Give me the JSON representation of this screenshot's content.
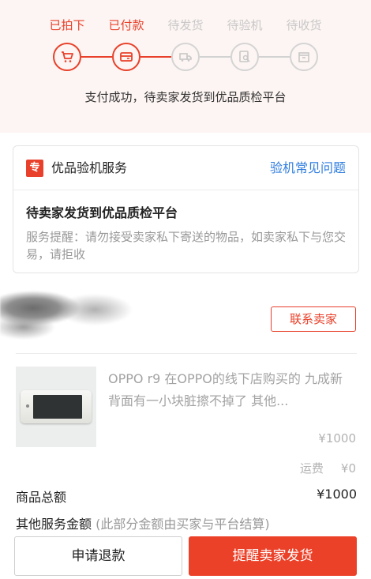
{
  "progress": {
    "steps": [
      {
        "label": "已拍下",
        "state": "active",
        "icon": "cart-icon"
      },
      {
        "label": "已付款",
        "state": "active",
        "icon": "card-icon"
      },
      {
        "label": "待发货",
        "state": "inactive",
        "icon": "truck-icon"
      },
      {
        "label": "待验机",
        "state": "inactive",
        "icon": "inspect-icon"
      },
      {
        "label": "待收货",
        "state": "inactive",
        "icon": "box-icon"
      }
    ],
    "status_text": "支付成功，待卖家发货到优品质检平台"
  },
  "inspection": {
    "badge": "专",
    "title": "优品验机服务",
    "faq_link": "验机常见问题",
    "status": "待卖家发货到优品质检平台",
    "notice": "服务提醒：请勿接受卖家私下寄送的物品，如卖家私下与您交易，请拒收"
  },
  "seller": {
    "contact_label": "联系卖家"
  },
  "product": {
    "title": "OPPO r9 在OPPO的线下店购买的 九成新 背面有一小块脏擦不掉了 其他...",
    "price": "¥1000",
    "shipping_label": "运费",
    "shipping_value": "¥0"
  },
  "summary": {
    "total_label": "商品总额",
    "total_value": "¥1000",
    "other_label": "其他服务金额",
    "other_note": "(此部分金额由买家与平台结算)"
  },
  "actions": {
    "refund_label": "申请退款",
    "remind_label": "提醒卖家发货"
  },
  "colors": {
    "accent": "#e8402a",
    "link": "#2f7ddf",
    "inactive": "#c8c8c8",
    "background_top": "#fdf5f3"
  }
}
